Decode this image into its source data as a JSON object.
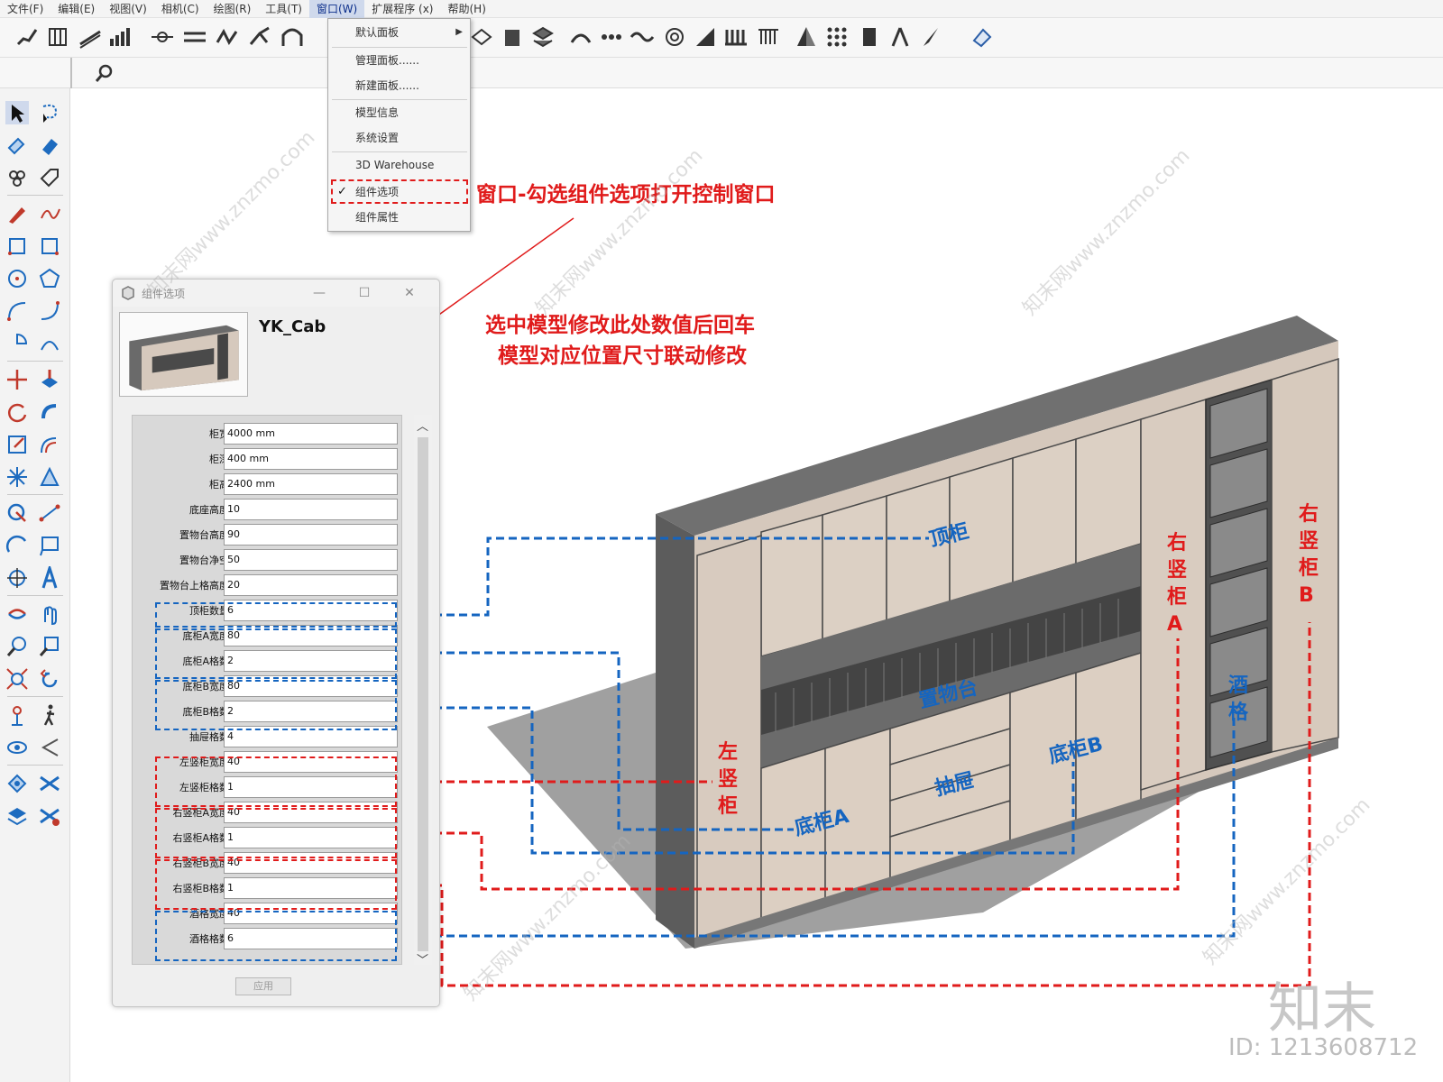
{
  "menubar": {
    "items": [
      "文件(F)",
      "编辑(E)",
      "视图(V)",
      "相机(C)",
      "绘图(R)",
      "工具(T)",
      "窗口(W)",
      "扩展程序 (x)",
      "帮助(H)"
    ],
    "active_index": 6
  },
  "window_menu": {
    "items": [
      {
        "label": "默认面板",
        "submenu": true
      },
      {
        "label": "管理面板......"
      },
      {
        "label": "新建面板......"
      },
      {
        "label": "模型信息"
      },
      {
        "label": "系统设置"
      },
      {
        "label": "3D Warehouse"
      },
      {
        "label": "组件选项",
        "checked": true,
        "check_mark": "✓"
      },
      {
        "label": "组件属性"
      }
    ]
  },
  "annotations": {
    "menu_hint": "窗口-勾选组件选项打开控制窗口",
    "dialog_hint_line1": "选中模型修改此处数值后回车",
    "dialog_hint_line2": "模型对应位置尺寸联动修改"
  },
  "dialog": {
    "title": "组件选项",
    "component_name": "YK_Cab",
    "apply_label": "应用",
    "params": [
      {
        "label": "柜宽",
        "value": "4000 mm"
      },
      {
        "label": "柜深",
        "value": "400 mm"
      },
      {
        "label": "柜高",
        "value": "2400 mm"
      },
      {
        "label": "底座高度",
        "value": "10"
      },
      {
        "label": "置物台高度",
        "value": "90"
      },
      {
        "label": "置物台净空",
        "value": "50"
      },
      {
        "label": "置物台上格高度",
        "value": "20"
      },
      {
        "label": "顶柜数量",
        "value": "6"
      },
      {
        "label": "底柜A宽度",
        "value": "80"
      },
      {
        "label": "底柜A格数",
        "value": "2"
      },
      {
        "label": "底柜B宽度",
        "value": "80"
      },
      {
        "label": "底柜B格数",
        "value": "2"
      },
      {
        "label": "抽屉格数",
        "value": "4"
      },
      {
        "label": "左竖柜宽度",
        "value": "40"
      },
      {
        "label": "左竖柜格数",
        "value": "1"
      },
      {
        "label": "右竖柜A宽度",
        "value": "40"
      },
      {
        "label": "右竖柜A格数",
        "value": "1"
      },
      {
        "label": "右竖柜B宽度",
        "value": "40"
      },
      {
        "label": "右竖柜B格数",
        "value": "1"
      },
      {
        "label": "酒格宽度",
        "value": "40"
      },
      {
        "label": "酒格格数",
        "value": "6"
      }
    ]
  },
  "model_labels": {
    "top_cabinet": "顶柜",
    "shelf_platform": "置物台",
    "bottom_a": "底柜A",
    "bottom_b": "底柜B",
    "drawer": "抽屉",
    "left_vertical": "左竖柜",
    "right_vertical_a": "右竖柜A",
    "right_vertical_b": "右竖柜B",
    "wine_rack": "酒格"
  },
  "watermark": {
    "logo": "知末",
    "id": "ID: 1213608712",
    "site": "知末网www.znzmo.com"
  },
  "colors": {
    "red": "#e01b1b",
    "blue": "#1565c0",
    "wood": "#d6c9bd",
    "dark": "#5e5e5e"
  }
}
